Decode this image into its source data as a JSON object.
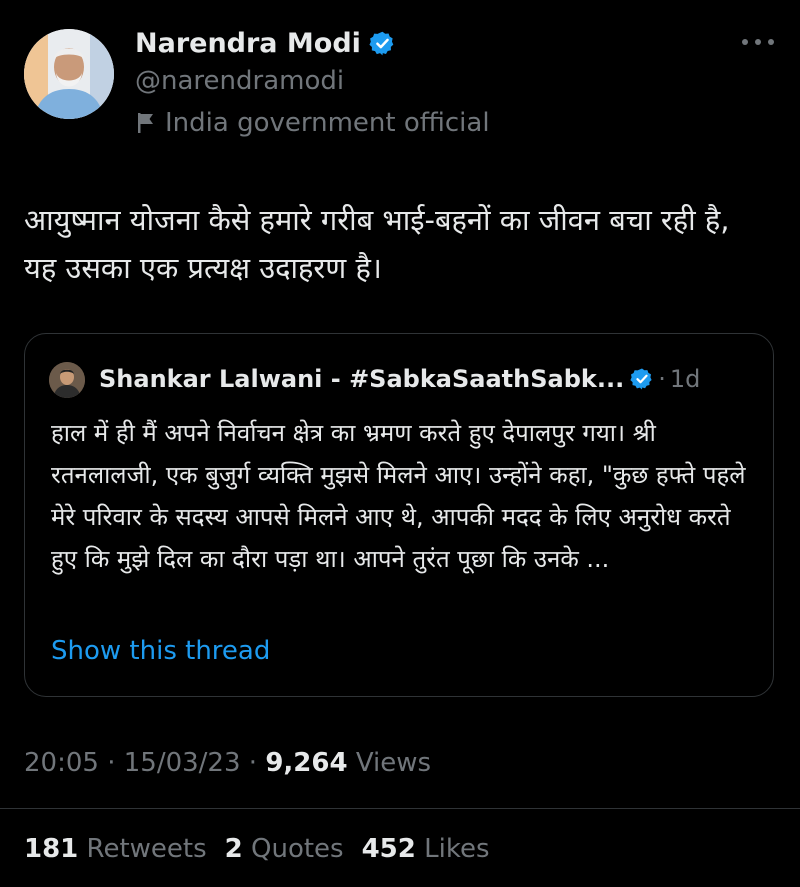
{
  "colors": {
    "background": "#000000",
    "primary_text": "#e7e9ea",
    "secondary_text": "#71767b",
    "link": "#1d9bf0",
    "verified": "#1d9bf0",
    "border": "#2f3336"
  },
  "tweet": {
    "author_name": "Narendra Modi",
    "handle": "@narendramodi",
    "affiliation": "India government official",
    "text": "आयुष्मान योजना कैसे हमारे गरीब भाई-बहनों का जीवन बचा रही है, यह उसका एक प्रत्यक्ष उदाहरण है।",
    "more_icon": "ellipsis-icon"
  },
  "quote": {
    "author_name": "Shankar Lalwani - #SabkaSaathSabk...",
    "separator": "·",
    "time": "1d",
    "text": "हाल में ही मैं अपने निर्वाचन क्षेत्र का भ्रमण करते हुए देपालपुर गया। श्री रतनलालजी, एक बुजुर्ग व्यक्ति मुझसे मिलने आए। उन्होंने कहा, \"कुछ हफ्ते पहले मेरे परिवार के सदस्य आपसे मिलने आए थे, आपकी मदद के लिए अनुरोध करते हुए कि मुझे दिल का दौरा पड़ा था। आपने तुरंत पूछा कि उनके  ...",
    "show_thread": "Show this thread"
  },
  "meta": {
    "time": "20:05",
    "sep1": " · ",
    "date": "15/03/23",
    "sep2": " · ",
    "views_count": "9,264",
    "views_label": " Views"
  },
  "stats": {
    "retweets_count": "181",
    "retweets_label": " Retweets",
    "quotes_count": "2",
    "quotes_label": " Quotes",
    "likes_count": "452",
    "likes_label": " Likes"
  }
}
